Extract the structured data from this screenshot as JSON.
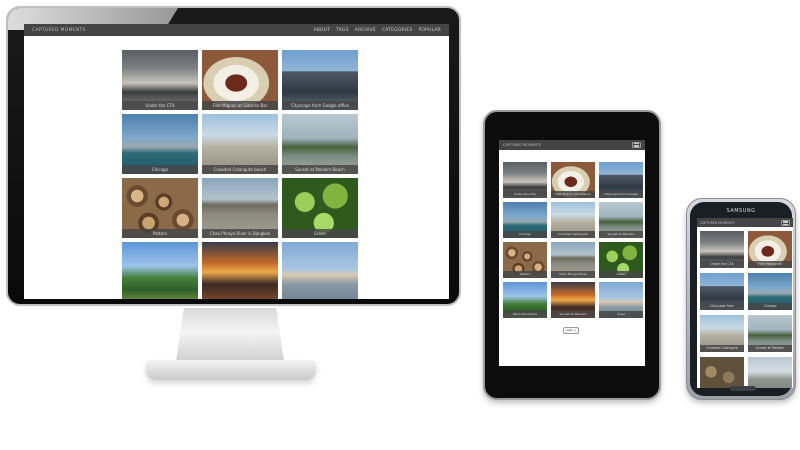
{
  "site": {
    "brand": "CAPTURED MOMENTS"
  },
  "desktop": {
    "nav": [
      "ABOUT",
      "TAGS",
      "ARCHIVE",
      "CATEGORIES",
      "POPULAR"
    ],
    "photos": [
      {
        "caption": "Under the CTA",
        "image": "ph-cta"
      },
      {
        "caption": "Filet Mignon at Gibsons Bar",
        "image": "ph-filet"
      },
      {
        "caption": "Cityscape from Google office",
        "image": "ph-city"
      },
      {
        "caption": "Chicago",
        "image": "ph-chicago"
      },
      {
        "caption": "Crowded Calangute beach",
        "image": "ph-crowd"
      },
      {
        "caption": "Sunset at Palolem Beach",
        "image": "ph-sunset"
      },
      {
        "caption": "Pattern",
        "image": "ph-firewood"
      },
      {
        "caption": "Chao Phraya River in Bangkok",
        "image": "ph-chao"
      },
      {
        "caption": "Green",
        "image": "ph-green"
      },
      {
        "caption": "",
        "image": "ph-mountain"
      },
      {
        "caption": "",
        "image": "ph-sunset2"
      },
      {
        "caption": "",
        "image": "ph-town"
      }
    ]
  },
  "tablet": {
    "photos": [
      {
        "caption": "Under the CTA",
        "image": "ph-cta"
      },
      {
        "caption": "Filet Mignon at Gibsons",
        "image": "ph-filet"
      },
      {
        "caption": "Cityscape from Google",
        "image": "ph-city"
      },
      {
        "caption": "Chicago",
        "image": "ph-chicago"
      },
      {
        "caption": "Crowded Calangute",
        "image": "ph-crowd"
      },
      {
        "caption": "Sunset at Palolem",
        "image": "ph-sunset"
      },
      {
        "caption": "Pattern",
        "image": "ph-firewood"
      },
      {
        "caption": "Chao Phraya River",
        "image": "ph-chao"
      },
      {
        "caption": "Green",
        "image": "ph-green"
      },
      {
        "caption": "Tatra Mountains",
        "image": "ph-mountain"
      },
      {
        "caption": "Sunset at Palolem",
        "image": "ph-sunset2"
      },
      {
        "caption": "Vrsar",
        "image": "ph-town"
      }
    ],
    "next_label": "next →"
  },
  "phone": {
    "brand": "SAMSUNG",
    "photos": [
      {
        "caption": "Under the CTA",
        "image": "ph-cta"
      },
      {
        "caption": "Filet Mignon at",
        "image": "ph-filet"
      },
      {
        "caption": "Cityscape from",
        "image": "ph-city"
      },
      {
        "caption": "Chicago",
        "image": "ph-chicago"
      },
      {
        "caption": "Crowded Calangute",
        "image": "ph-crowd"
      },
      {
        "caption": "Sunset at Palolem",
        "image": "ph-sunset"
      },
      {
        "caption": "",
        "image": "ph-stones"
      },
      {
        "caption": "",
        "image": "ph-river"
      }
    ]
  }
}
